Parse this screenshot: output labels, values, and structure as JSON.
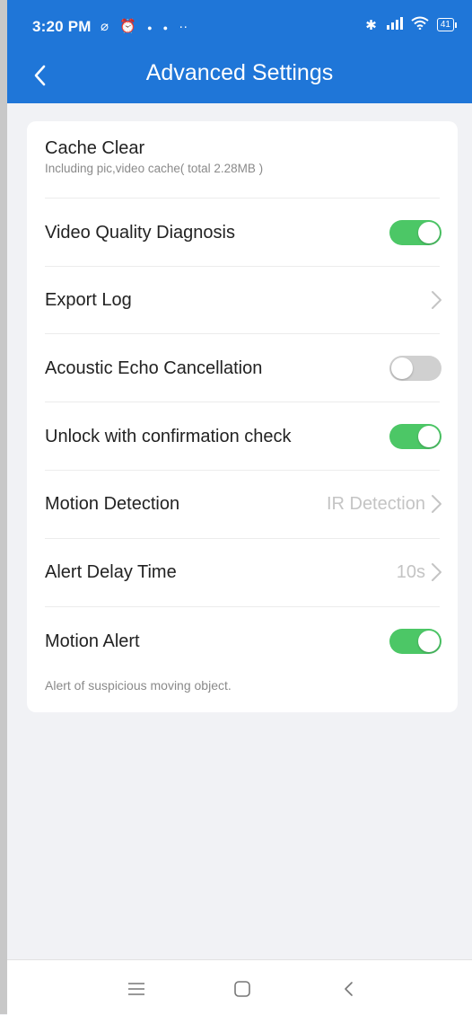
{
  "status_bar": {
    "time": "3:20 PM",
    "battery": "41"
  },
  "header": {
    "title": "Advanced Settings"
  },
  "settings": {
    "cache_clear": {
      "label": "Cache Clear",
      "description": "Including pic,video cache( total 2.28MB )"
    },
    "video_quality_diagnosis": {
      "label": "Video Quality Diagnosis",
      "enabled": true
    },
    "export_log": {
      "label": "Export Log"
    },
    "acoustic_echo_cancellation": {
      "label": "Acoustic Echo Cancellation",
      "enabled": false
    },
    "unlock_confirmation": {
      "label": "Unlock with confirmation check",
      "enabled": true
    },
    "motion_detection": {
      "label": "Motion Detection",
      "value": "IR Detection"
    },
    "alert_delay_time": {
      "label": "Alert Delay Time",
      "value": "10s"
    },
    "motion_alert": {
      "label": "Motion Alert",
      "enabled": true,
      "description": "Alert of suspicious moving object."
    }
  },
  "colors": {
    "header": "#1f76d8",
    "toggle_on": "#4cc766",
    "toggle_off": "#d0d0d0",
    "background": "#f1f2f5"
  },
  "icons": {
    "back": "chevron-left-icon",
    "row_chevron": "chevron-right-icon",
    "menu": "menu-icon",
    "home": "home-square-icon",
    "nav_back": "back-icon"
  }
}
